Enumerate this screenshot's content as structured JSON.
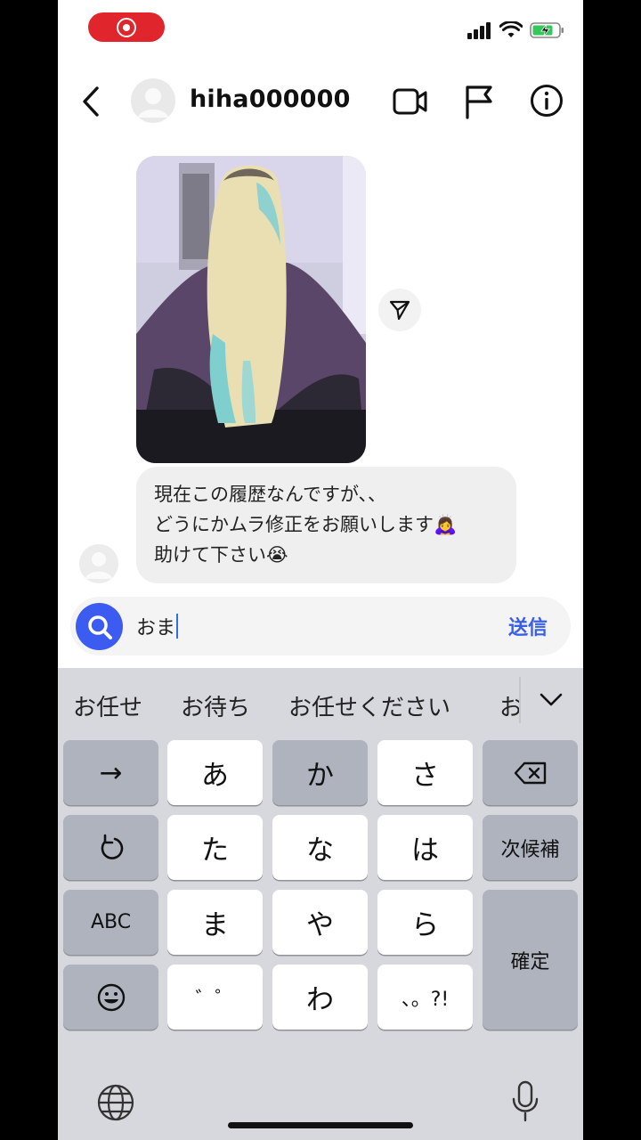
{
  "status_bar": {
    "record_icon": "screen-record-icon",
    "signal_icon": "cellular-signal-icon",
    "wifi_icon": "wifi-icon",
    "battery_icon": "battery-charging-icon"
  },
  "header": {
    "username": "hiha000000",
    "icons": [
      "back-chevron-icon",
      "video-call-icon",
      "flag-icon",
      "info-icon"
    ]
  },
  "thread": {
    "photo_description_icon": "hair-photo",
    "share_icon": "send-icon",
    "message_lines": [
      "現在この履歴なんですが、、",
      "どうにかムラ修正をお願いします🙇‍♀️",
      "助けて下さい😭"
    ]
  },
  "composer": {
    "input_value": "おま",
    "send_label": "送信",
    "search_icon": "search-icon"
  },
  "keyboard": {
    "candidates": [
      "お任せ",
      "お待ち",
      "お任せください",
      "お"
    ],
    "keys": {
      "arrow": "→",
      "a": "あ",
      "ka": "か",
      "sa": "さ",
      "undo_icon": "undo-icon",
      "ta": "た",
      "na": "な",
      "ha": "は",
      "next_candidate": "次候補",
      "abc": "ABC",
      "ma": "ま",
      "ya": "や",
      "ra": "ら",
      "confirm": "確定",
      "dakuten": "゛゜",
      "wa": "わ",
      "punct": "、。?!"
    },
    "globe_icon": "globe-icon",
    "mic_icon": "microphone-icon"
  },
  "colors": {
    "record_red": "#e0252c",
    "accent_blue": "#3c5bf0",
    "keyboard_bg": "#d6d8dd"
  }
}
